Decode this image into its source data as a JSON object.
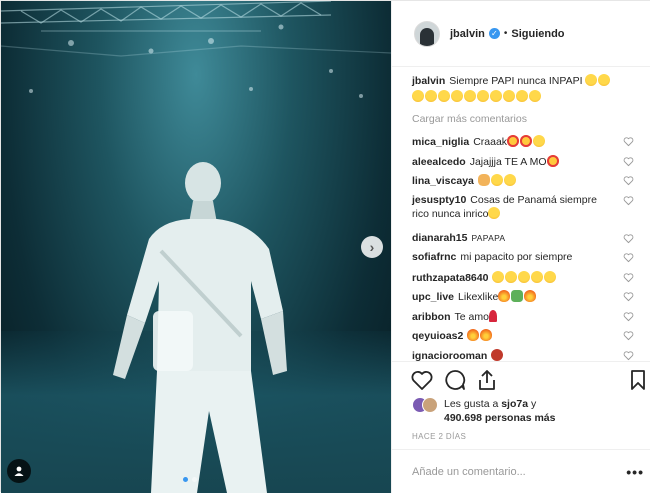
{
  "post": {
    "username": "jbalvin",
    "follow_dot": "•",
    "follow_label": "Siguiendo",
    "verified_mark": "✓",
    "caption_user": "jbalvin",
    "caption_text": "Siempre PAPI nunca INPAPI",
    "load_more": "Cargar más comentarios",
    "next_arrow": "›",
    "image_alt": "Artista en el escenario frente al público"
  },
  "comments": [
    {
      "user": "mica_niglia",
      "text": "Craaak",
      "emojis": [
        "hearteye",
        "hearteye",
        "laugh"
      ],
      "tall": false
    },
    {
      "user": "aleealcedo",
      "text": "Jajajjja TE A MO",
      "emojis": [
        "hearteye"
      ],
      "tall": false
    },
    {
      "user": "lina_viscaya",
      "text": "",
      "emojis": [
        "hand",
        "laugh",
        "laugh"
      ],
      "tall": false
    },
    {
      "user": "jesuspty10",
      "text": "Cosas de Panamá siempre rico nunca inrico",
      "emojis": [
        "laugh"
      ],
      "tall": true
    },
    {
      "user": "dianarah15",
      "text": "PAPAPA",
      "emojis": [],
      "tall": false,
      "small": true
    },
    {
      "user": "sofiafrnc",
      "text": "mi papacito por siempre",
      "emojis": [],
      "tall": false
    },
    {
      "user": "ruthzapata8640",
      "text": "",
      "emojis": [
        "laugh",
        "laugh",
        "laugh",
        "laugh",
        "laugh"
      ],
      "tall": false
    },
    {
      "user": "upc_live",
      "text": "Likexlike",
      "emojis": [
        "fire",
        "money",
        "fire"
      ],
      "tall": false
    },
    {
      "user": "aribbon",
      "text": "Te amo",
      "emojis": [
        "rose"
      ],
      "tall": false
    },
    {
      "user": "qeyuioas2",
      "text": "",
      "emojis": [
        "fire",
        "fire"
      ],
      "tall": false
    },
    {
      "user": "ignaciorooman",
      "text": "",
      "emojis": [
        "devil"
      ],
      "tall": false
    }
  ],
  "likes": {
    "prefix": "Les gusta a",
    "user": "sjo7a",
    "joiner": "y",
    "count": "490.698 personas más"
  },
  "time_label": "HACE 2 DÍAS",
  "add_comment_placeholder": "Añade un comentario...",
  "more_label": "•••",
  "colors": {
    "accent": "#3897f0",
    "text": "#262626",
    "muted": "#999999",
    "border": "#efefef",
    "photo_teal": "#1e5560"
  },
  "icons": [
    "verified-icon",
    "heart-icon",
    "comment-icon",
    "share-icon",
    "bookmark-icon",
    "user-tag-icon",
    "next-arrow-icon",
    "more-icon"
  ]
}
